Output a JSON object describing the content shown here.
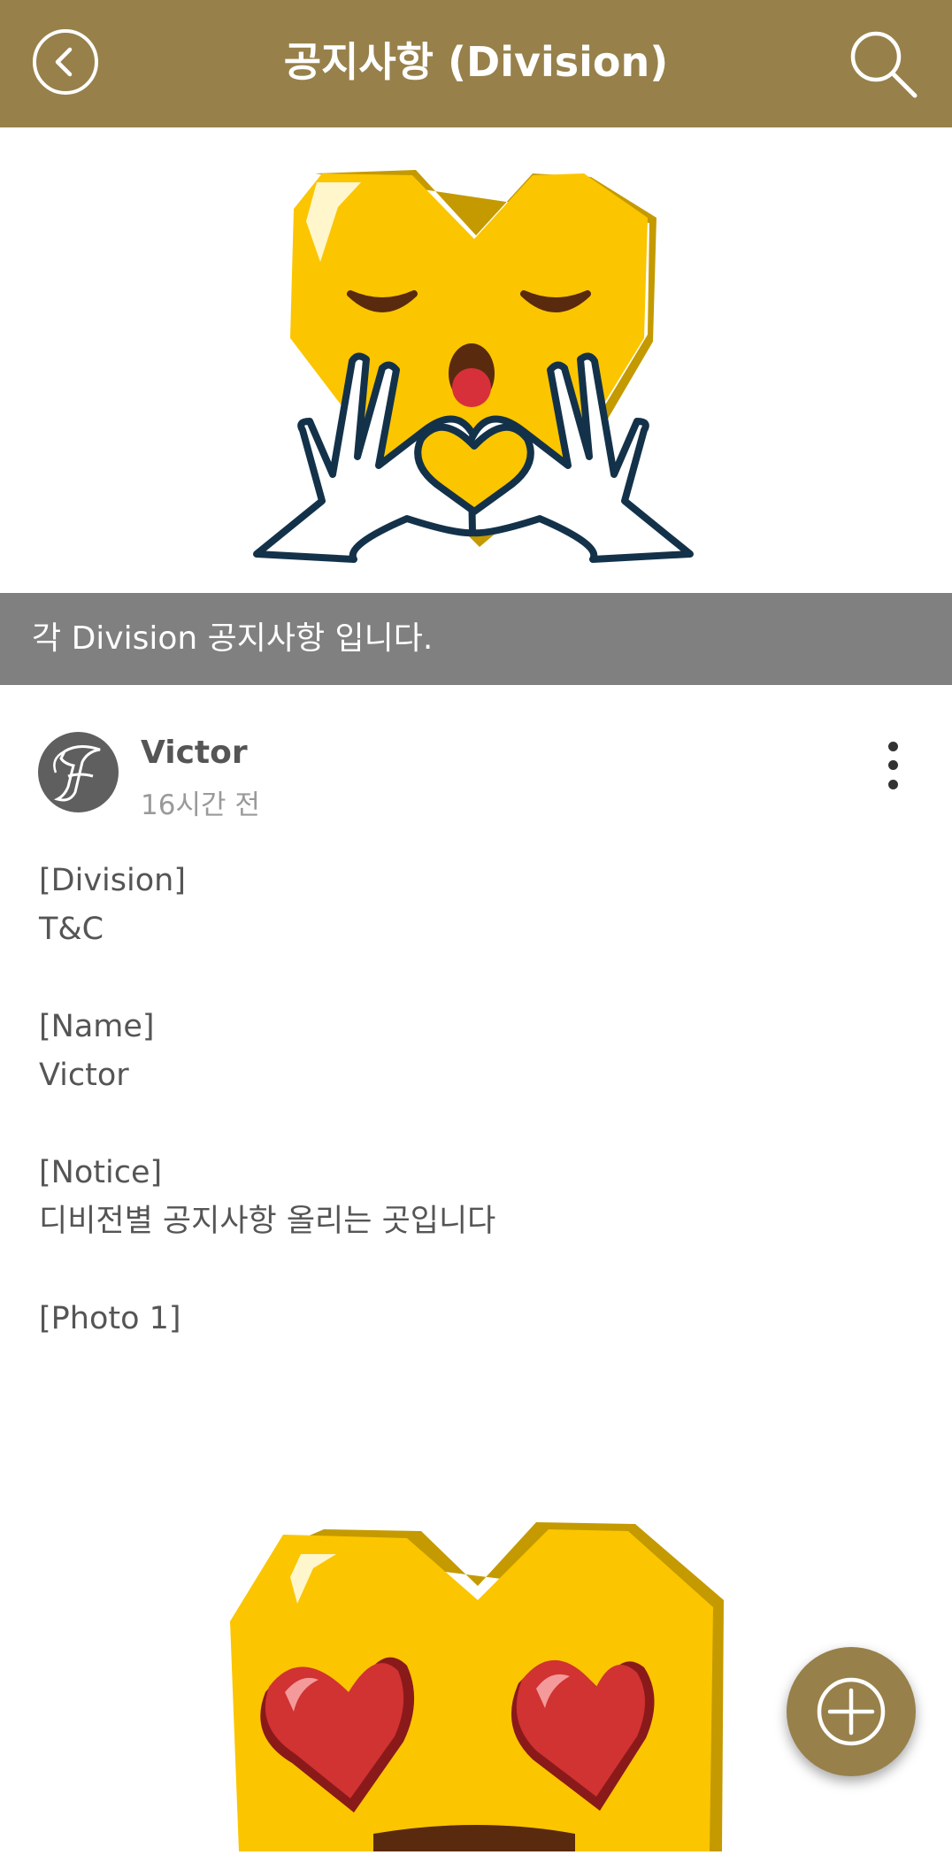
{
  "appbar": {
    "title": "공지사항 (Division)",
    "back_icon": "chevron-left-circle-icon",
    "search_icon": "search-icon",
    "color": "#97804a"
  },
  "hero": {
    "image": "heart-emoji-blowing-kiss-with-heart-hands"
  },
  "banner": {
    "text": "각 Division 공지사항 입니다.",
    "color": "#808080"
  },
  "post": {
    "author": "Victor",
    "time": "16시간 전",
    "avatar_icon": "script-letter-f-avatar",
    "menu_icon": "more-vertical-icon",
    "fields": [
      {
        "label": "[Division]",
        "value": "T&C"
      },
      {
        "label": "[Name]",
        "value": "Victor"
      },
      {
        "label": "[Notice]",
        "value": "디비전별 공지사항 올리는 곳입니다"
      }
    ],
    "photo_label": "[Photo 1]",
    "photo_image": "heart-emoji-with-heart-eyes"
  },
  "fab": {
    "icon": "plus-circle-icon"
  }
}
